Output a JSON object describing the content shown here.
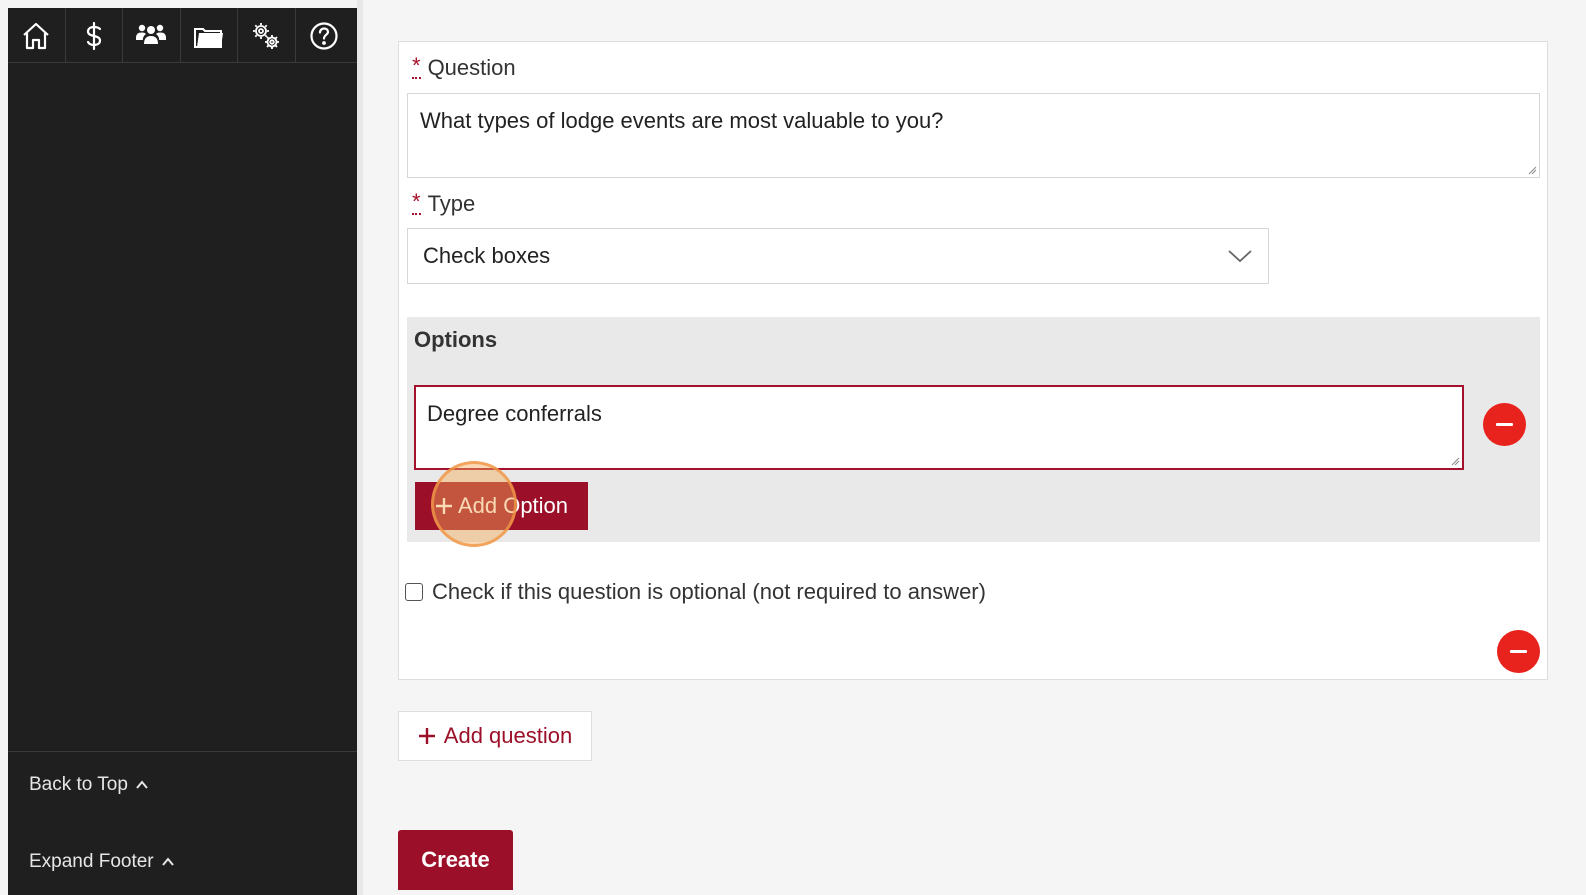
{
  "sidebar": {
    "nav_icons": [
      "home-icon",
      "dollar-icon",
      "people-icon",
      "folder-icon",
      "settings-icon",
      "help-icon"
    ],
    "back_to_top": "Back to Top",
    "expand_footer": "Expand Footer"
  },
  "form": {
    "question_label": "Question",
    "question_required_marker": "*",
    "question_value": "What types of lodge events are most valuable to you?",
    "type_label": "Type",
    "type_required_marker": "*",
    "type_selected": "Check boxes",
    "options_title": "Options",
    "option_values": [
      "Degree conferrals"
    ],
    "add_option_label": "Add Option",
    "optional_checkbox_label": "Check if this question is optional (not required to answer)",
    "optional_checked": false
  },
  "actions": {
    "add_question_label": "Add question",
    "create_label": "Create"
  },
  "colors": {
    "brand": "#9b1028",
    "remove": "#e8231e",
    "sidebar_bg": "#1f1f1f"
  }
}
